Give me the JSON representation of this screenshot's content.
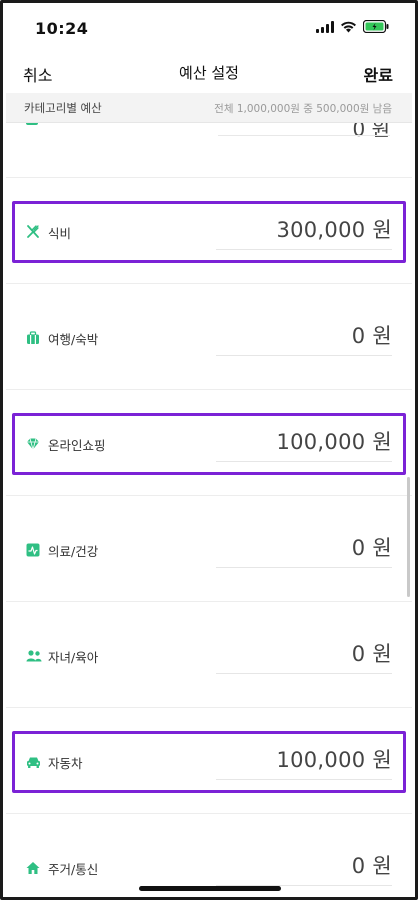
{
  "status_bar": {
    "time": "10:24"
  },
  "nav": {
    "cancel": "취소",
    "title": "예산 설정",
    "done": "완료"
  },
  "section": {
    "title": "카테고리별 예산",
    "summary": "전체 1,000,000원 중 500,000원 남음"
  },
  "partial_row": {
    "value": "0 원"
  },
  "categories": [
    {
      "label": "식비",
      "value": "300,000 원",
      "icon": "fork-knife-icon",
      "highlighted": true
    },
    {
      "label": "여행/숙박",
      "value": "0 원",
      "icon": "luggage-icon",
      "highlighted": false
    },
    {
      "label": "온라인쇼핑",
      "value": "100,000 원",
      "icon": "diamond-icon",
      "highlighted": true
    },
    {
      "label": "의료/건강",
      "value": "0 원",
      "icon": "health-chart-icon",
      "highlighted": false
    },
    {
      "label": "자녀/육아",
      "value": "0 원",
      "icon": "people-icon",
      "highlighted": false
    },
    {
      "label": "자동차",
      "value": "100,000 원",
      "icon": "car-icon",
      "highlighted": true
    },
    {
      "label": "주거/통신",
      "value": "0 원",
      "icon": "home-icon",
      "highlighted": false
    }
  ],
  "colors": {
    "accent": "#2fbf83",
    "highlight": "#7b22d6",
    "battery": "#33c759"
  }
}
